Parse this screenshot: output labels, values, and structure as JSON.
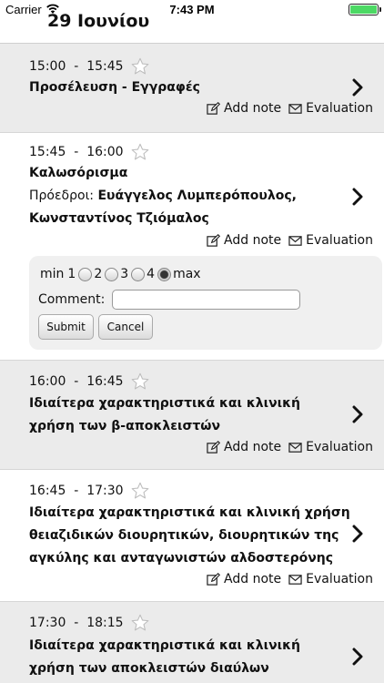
{
  "status_bar": {
    "carrier": "Carrier",
    "time": "7:43 PM"
  },
  "date_title": "29 Ιουνίου",
  "labels": {
    "add_note": "Add note",
    "evaluation": "Evaluation",
    "chairs_prefix": "Πρόεδροι:"
  },
  "sessions": [
    {
      "start": "15:00",
      "end": "15:45",
      "sep": "-",
      "title": "Προσέλευση - Εγγραφές"
    },
    {
      "start": "15:45",
      "end": "16:00",
      "sep": "-",
      "title": "Καλωσόρισμα",
      "chairs": "Ευάγγελος Λυμπερόπουλος, Κωνσταντίνος Τζιόμαλος"
    },
    {
      "start": "16:00",
      "end": "16:45",
      "sep": "-",
      "title": "Ιδιαίτερα χαρακτηριστικά και κλινική χρήση των β-αποκλειστών"
    },
    {
      "start": "16:45",
      "end": "17:30",
      "sep": "-",
      "title": "Ιδιαίτερα χαρακτηριστικά και κλινική χρήση θειαζιδικών διουρητικών, διουρητικών της αγκύλης και ανταγωνιστών αλδοστερόνης"
    },
    {
      "start": "17:30",
      "end": "18:15",
      "sep": "-",
      "title": "Ιδιαίτερα χαρακτηριστικά και κλινική χρήση των αποκλειστών διαύλων ασβεστίου"
    }
  ],
  "evaluation_form": {
    "min_label": "min",
    "max_label": "max",
    "options": [
      "1",
      "2",
      "3",
      "4"
    ],
    "selected": "max",
    "comment_label": "Comment:",
    "comment_value": "",
    "submit_label": "Submit",
    "cancel_label": "Cancel"
  },
  "colors": {
    "gray_row": "#ebebeb",
    "white_row": "#ffffff",
    "battery": "#4cd964"
  }
}
